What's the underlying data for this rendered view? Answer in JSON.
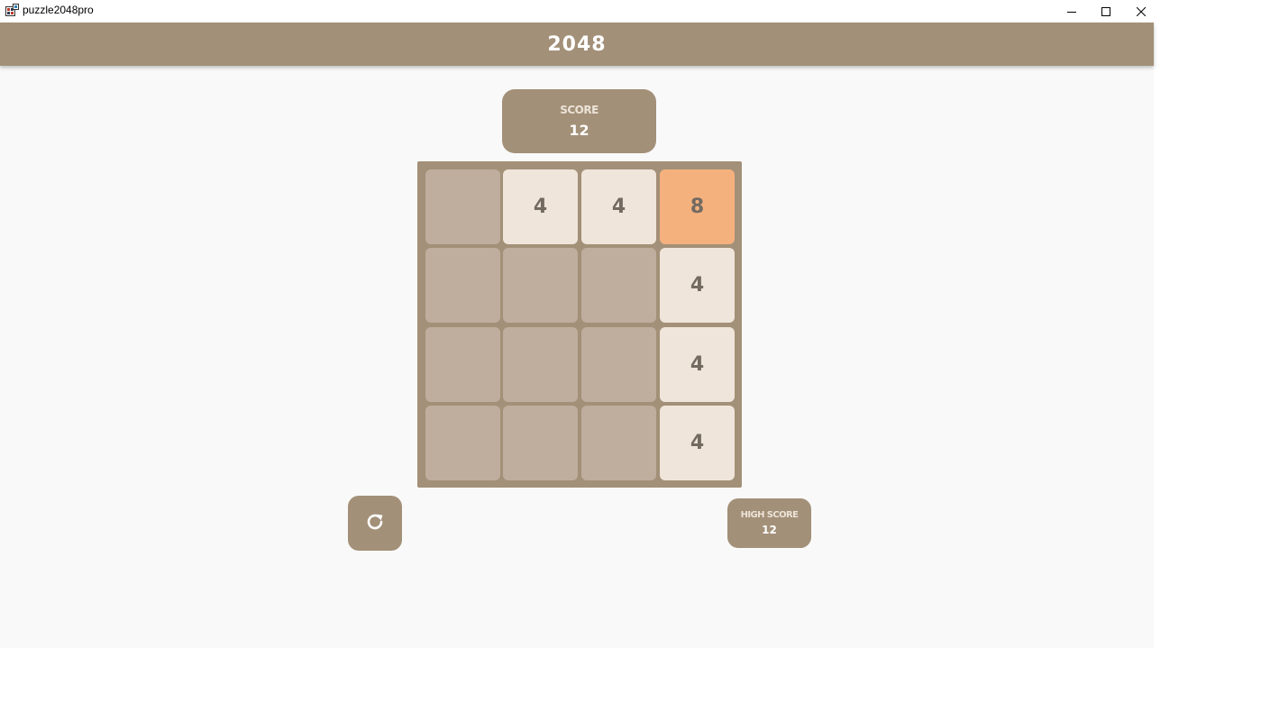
{
  "window": {
    "title": "puzzle2048pro",
    "icons": {
      "app": "app-icon",
      "minimize": "minimize-icon",
      "maximize": "maximize-icon",
      "close": "close-icon"
    }
  },
  "appbar": {
    "title": "2048"
  },
  "score": {
    "label": "SCORE",
    "value": "12"
  },
  "high_score": {
    "label": "HIGH SCORE",
    "value": "12"
  },
  "restart": {
    "icon": "refresh-icon"
  },
  "board": {
    "rows": [
      [
        "",
        "4",
        "4",
        "8"
      ],
      [
        "",
        "",
        "",
        "4"
      ],
      [
        "",
        "",
        "",
        "4"
      ],
      [
        "",
        "",
        "",
        "4"
      ]
    ]
  },
  "colors": {
    "primary": "#a39078",
    "empty_tile": "#bfae9e",
    "tile_4": "#efe5da",
    "tile_8": "#f4b17e",
    "tile_text": "#736a62",
    "background": "#f9f9f9"
  }
}
